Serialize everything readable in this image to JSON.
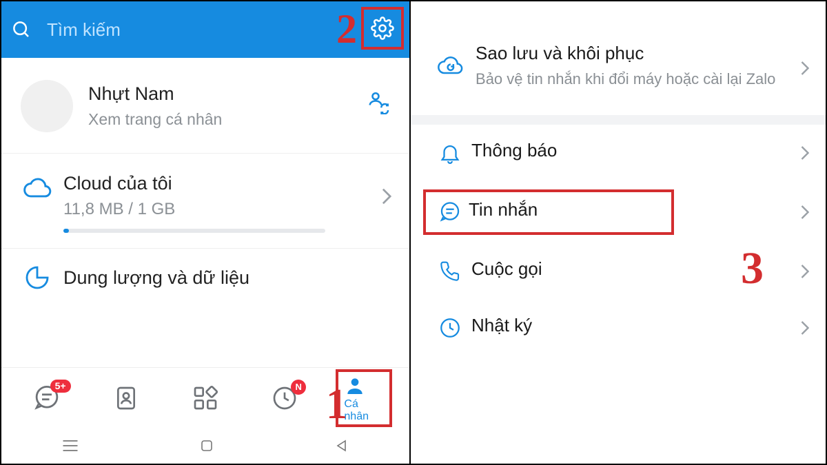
{
  "colors": {
    "primary": "#168be0",
    "highlight_border": "#d32d2f",
    "text_muted": "#8b9095",
    "badge": "#ee2e3d"
  },
  "steps": {
    "one": "1",
    "two": "2",
    "three": "3"
  },
  "left": {
    "search_placeholder": "Tìm kiếm",
    "profile": {
      "name": "Nhựt Nam",
      "subtitle": "Xem trang cá nhân"
    },
    "cloud": {
      "title": "Cloud của tôi",
      "detail": "11,8 MB / 1 GB",
      "progress_percent": 2
    },
    "storage": {
      "title": "Dung lượng và dữ liệu"
    },
    "bottom_nav": {
      "messages_badge": "5+",
      "timeline_badge": "N",
      "personal_label": "Cá nhân"
    }
  },
  "right": {
    "backup": {
      "title": "Sao lưu và khôi phục",
      "subtitle": "Bảo vệ tin nhắn khi đổi máy hoặc cài lại Zalo"
    },
    "items": {
      "notifications": "Thông báo",
      "messages": "Tin nhắn",
      "calls": "Cuộc gọi",
      "diary": "Nhật ký"
    }
  }
}
